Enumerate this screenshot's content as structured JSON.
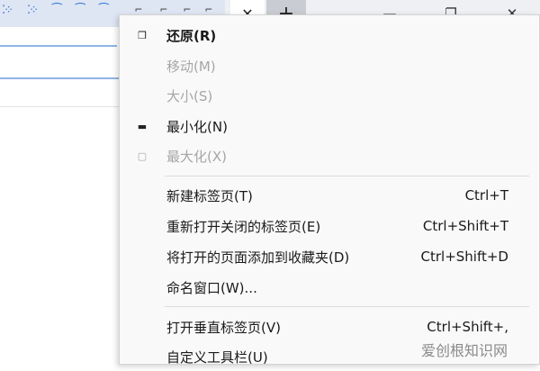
{
  "titlebar": {
    "close_tab_glyph": "✕",
    "new_tab_glyph": "+",
    "minimize_glyph": "—",
    "restore_glyph": "❐",
    "close_window_glyph": "✕"
  },
  "menu": {
    "items": [
      {
        "label": "还原(R)",
        "shortcut": "",
        "icon": "restore-icon",
        "icon_glyph": "❐",
        "state": "bold"
      },
      {
        "label": "移动(M)",
        "shortcut": "",
        "icon": "",
        "icon_glyph": "",
        "state": "disabled"
      },
      {
        "label": "大小(S)",
        "shortcut": "",
        "icon": "",
        "icon_glyph": "",
        "state": "disabled"
      },
      {
        "label": "最小化(N)",
        "shortcut": "",
        "icon": "minimize-icon",
        "icon_glyph": "▬",
        "state": "normal"
      },
      {
        "label": "最大化(X)",
        "shortcut": "",
        "icon": "maximize-icon",
        "icon_glyph": "▢",
        "state": "disabled"
      },
      {
        "label": "新建标签页(T)",
        "shortcut": "Ctrl+T",
        "icon": "",
        "icon_glyph": "",
        "state": "normal"
      },
      {
        "label": "重新打开关闭的标签页(E)",
        "shortcut": "Ctrl+Shift+T",
        "icon": "",
        "icon_glyph": "",
        "state": "normal"
      },
      {
        "label": "将打开的页面添加到收藏夹(D)",
        "shortcut": "Ctrl+Shift+D",
        "icon": "",
        "icon_glyph": "",
        "state": "normal"
      },
      {
        "label": "命名窗口(W)...",
        "shortcut": "",
        "icon": "",
        "icon_glyph": "",
        "state": "normal"
      },
      {
        "label": "打开垂直标签页(V)",
        "shortcut": "Ctrl+Shift+,",
        "icon": "",
        "icon_glyph": "",
        "state": "normal"
      },
      {
        "label": "自定义工具栏(U)",
        "shortcut": "",
        "icon": "",
        "icon_glyph": "",
        "state": "normal"
      }
    ]
  },
  "watermark": "爱创根知识网"
}
